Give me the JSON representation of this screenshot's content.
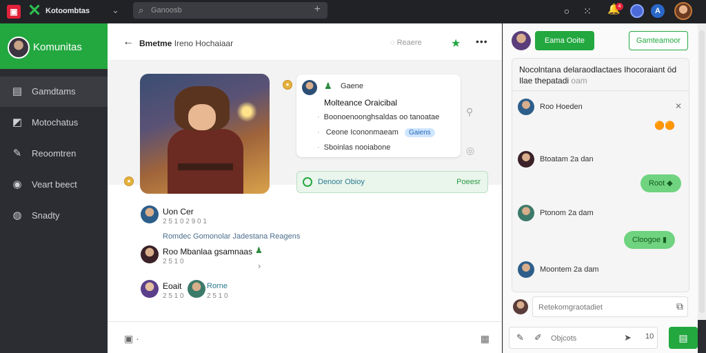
{
  "topbar": {
    "app_name": "Kotoombtas",
    "search_placeholder": "Ganoosb",
    "notif_count": "4"
  },
  "sidebar": {
    "title": "Komunitas",
    "items": [
      {
        "label": "Gamdtams",
        "icon": "cards-icon"
      },
      {
        "label": "Motochatus",
        "icon": "chart-icon"
      },
      {
        "label": "Reoomtren",
        "icon": "brush-icon"
      },
      {
        "label": "Veart beect",
        "icon": "pin-icon"
      },
      {
        "label": "Snadty",
        "icon": "globe-icon"
      }
    ]
  },
  "main": {
    "header_title_bold": "Bmetme",
    "header_title_rest": "Ireno Hochaiaar",
    "header_status": "Reaere",
    "post_card": {
      "name": "Gaene",
      "title": "Molteance Oraicibal",
      "lines": [
        "Boonoenoonghsaldas oo tanoatae",
        "Ceone Icononmaeam",
        "Sboinlas nooiabone"
      ],
      "pill": "Gaiens"
    },
    "poll_bar": {
      "label": "Denoor Obioy",
      "action": "Poeesr"
    },
    "thread": {
      "item1_name": "Uon Cer",
      "item1_meta": "2 5 1 0  2 9 0 1",
      "item1_line": "Romdec Gomonolar Jadestana Reagens",
      "item2_name": "Roo Mbanlaa gsamnaas",
      "item2_meta": "2 5 1 0",
      "item3_name": "Eoait",
      "item3_meta": "2 5 1 0",
      "item3_reply": "Rorne",
      "item3_reply_meta": "2 5 1 0"
    }
  },
  "right_panel": {
    "btn_primary": "Eama Ooite",
    "btn_secondary": "Gamteamoor",
    "topic": "Nocolntana delaraodlactaes Ihocoraiant öd",
    "topic_sub": "Ilae thepatadi",
    "topic_sub_tail": "oam",
    "chat": [
      {
        "name": "Roo Hoeden"
      },
      {
        "name": "Btoatam 2a dan"
      },
      {
        "name": "Ptonom 2a dam"
      },
      {
        "name": "Moontem 2a dam"
      }
    ],
    "bubble1": "Root",
    "bubble2": "Cloogoe",
    "input_placeholder": "Retekomgraotadiet",
    "compose_placeholder": "Objcots",
    "count": "10"
  },
  "colors": {
    "brand_green": "#23a840",
    "sidebar_bg": "#2b2d32",
    "alert_red": "#e2213a"
  }
}
